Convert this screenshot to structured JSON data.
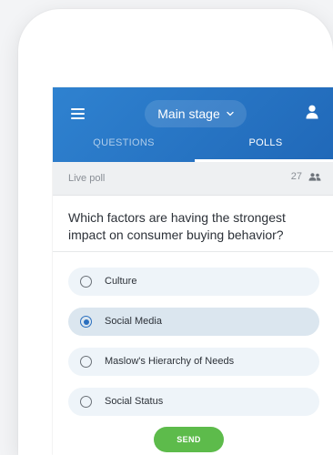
{
  "header": {
    "stage_label": "Main stage",
    "tabs": [
      {
        "label": "QUESTIONS",
        "active": false
      },
      {
        "label": "POLLS",
        "active": true
      }
    ],
    "accent_color": "#2a74c4"
  },
  "poll": {
    "status_label": "Live poll",
    "participant_count": "27",
    "question": "Which factors are having the strongest impact on consumer buying behavior?",
    "options": [
      {
        "label": "Culture",
        "selected": false
      },
      {
        "label": "Social Media",
        "selected": true
      },
      {
        "label": "Maslow's Hierarchy of Needs",
        "selected": false
      },
      {
        "label": "Social Status",
        "selected": false
      }
    ],
    "send_label": "SEND",
    "send_color": "#5dbb4b"
  },
  "icons": {
    "menu": "menu-icon",
    "dropdown": "chevron-down-icon",
    "user": "user-icon",
    "participants": "people-icon"
  }
}
